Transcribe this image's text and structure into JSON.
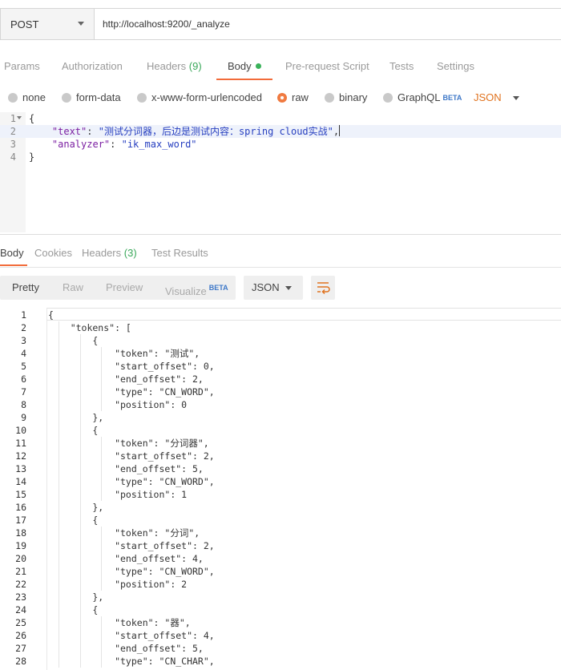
{
  "request": {
    "method": "POST",
    "url": "http://localhost:9200/_analyze"
  },
  "request_tabs": [
    {
      "label": "Params",
      "count": ""
    },
    {
      "label": "Authorization",
      "count": ""
    },
    {
      "label": "Headers",
      "count": "(9)"
    },
    {
      "label": "Body",
      "count": ""
    },
    {
      "label": "Pre-request Script",
      "count": ""
    },
    {
      "label": "Tests",
      "count": ""
    },
    {
      "label": "Settings",
      "count": ""
    }
  ],
  "body_types": {
    "none": "none",
    "form_data": "form-data",
    "urlencoded": "x-www-form-urlencoded",
    "raw": "raw",
    "binary": "binary",
    "graphql": "GraphQL",
    "beta": "BETA",
    "language": "JSON"
  },
  "request_body": {
    "line_numbers": [
      "1",
      "2",
      "3",
      "4"
    ],
    "open": "{",
    "text_key": "\"text\"",
    "text_value": "\"测试分词器，后边是测试内容：spring cloud实战\"",
    "analyzer_key": "\"analyzer\"",
    "analyzer_value": "\"ik_max_word\"",
    "close": "}"
  },
  "response_tabs": [
    {
      "label": "Body",
      "count": ""
    },
    {
      "label": "Cookies",
      "count": ""
    },
    {
      "label": "Headers",
      "count": "(3)"
    },
    {
      "label": "Test Results",
      "count": ""
    }
  ],
  "format": {
    "pretty": "Pretty",
    "raw": "Raw",
    "preview": "Preview",
    "visualize": "Visualize",
    "beta": "BETA",
    "language": "JSON"
  },
  "response_body": {
    "lines": [
      "{",
      "    \"tokens\": [",
      "        {",
      "            \"token\": \"测试\",",
      "            \"start_offset\": 0,",
      "            \"end_offset\": 2,",
      "            \"type\": \"CN_WORD\",",
      "            \"position\": 0",
      "        },",
      "        {",
      "            \"token\": \"分词器\",",
      "            \"start_offset\": 2,",
      "            \"end_offset\": 5,",
      "            \"type\": \"CN_WORD\",",
      "            \"position\": 1",
      "        },",
      "        {",
      "            \"token\": \"分词\",",
      "            \"start_offset\": 2,",
      "            \"end_offset\": 4,",
      "            \"type\": \"CN_WORD\",",
      "            \"position\": 2",
      "        },",
      "        {",
      "            \"token\": \"器\",",
      "            \"start_offset\": 4,",
      "            \"end_offset\": 5,",
      "            \"type\": \"CN_CHAR\","
    ],
    "line_numbers": [
      "1",
      "2",
      "3",
      "4",
      "5",
      "6",
      "7",
      "8",
      "9",
      "10",
      "11",
      "12",
      "13",
      "14",
      "15",
      "16",
      "17",
      "18",
      "19",
      "20",
      "21",
      "22",
      "23",
      "24",
      "25",
      "26",
      "27",
      "28"
    ]
  }
}
